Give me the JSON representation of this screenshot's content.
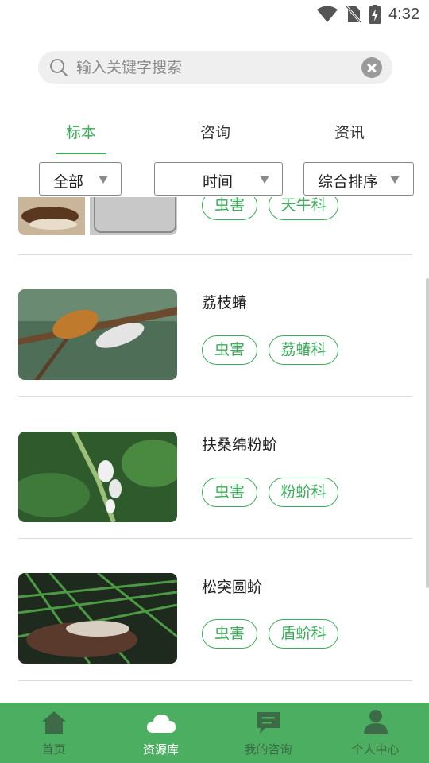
{
  "status_bar": {
    "time": "4:32"
  },
  "search": {
    "placeholder": "输入关键字搜索"
  },
  "tabs": [
    {
      "label": "标本",
      "active": true
    },
    {
      "label": "咨询",
      "active": false
    },
    {
      "label": "资讯",
      "active": false
    }
  ],
  "filters": [
    {
      "label": "全部"
    },
    {
      "label": "时间"
    },
    {
      "label": "综合排序"
    }
  ],
  "items": [
    {
      "title": "",
      "tags": [
        "虫害",
        "天牛科"
      ]
    },
    {
      "title": "荔枝蝽",
      "tags": [
        "虫害",
        "荔蝽科"
      ]
    },
    {
      "title": "扶桑绵粉蚧",
      "tags": [
        "虫害",
        "粉蚧科"
      ]
    },
    {
      "title": "松突圆蚧",
      "tags": [
        "虫害",
        "盾蚧科"
      ]
    }
  ],
  "bottom_nav": [
    {
      "label": "首页",
      "icon": "home-icon",
      "active": false
    },
    {
      "label": "资源库",
      "icon": "cloud-icon",
      "active": true
    },
    {
      "label": "我的咨询",
      "icon": "chat-icon",
      "active": false
    },
    {
      "label": "个人中心",
      "icon": "person-icon",
      "active": false
    }
  ],
  "colors": {
    "accent": "#3cad5a",
    "nav_bg": "#4cae60"
  }
}
